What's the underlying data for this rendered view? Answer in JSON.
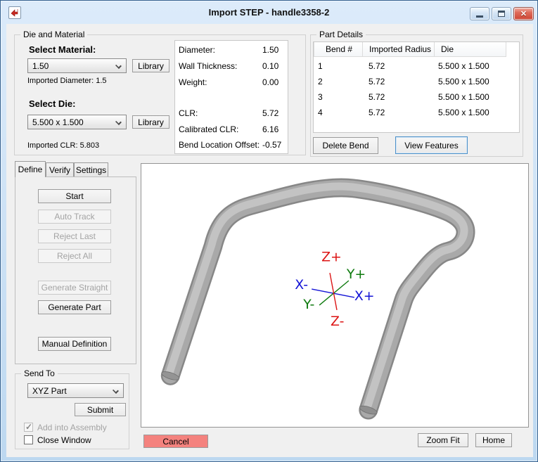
{
  "window": {
    "title": "Import STEP - handle3358-2",
    "controls": {
      "minimize": "minimize-icon",
      "maximize": "maximize-icon",
      "close": "close-icon",
      "close_glyph": "✕"
    }
  },
  "die_and_material": {
    "group_label": "Die and Material",
    "select_material_label": "Select Material:",
    "material_value": "1.50",
    "material_library_button": "Library",
    "imported_diameter": "Imported Diameter: 1.5",
    "select_die_label": "Select Die:",
    "die_value": "5.500 x 1.500",
    "die_library_button": "Library",
    "imported_clr": "Imported CLR: 5.803"
  },
  "material_details": {
    "rows": [
      {
        "label": "Diameter:",
        "value": "1.50"
      },
      {
        "label": "Wall Thickness:",
        "value": "0.10"
      },
      {
        "label": "Weight:",
        "value": "0.00"
      },
      {
        "label": "CLR:",
        "value": "5.72"
      },
      {
        "label": "Calibrated CLR:",
        "value": "6.16"
      },
      {
        "label": "Bend Location Offset:",
        "value": "-0.57"
      }
    ]
  },
  "part_details": {
    "group_label": "Part Details",
    "columns": [
      "Bend #",
      "Imported Radius",
      "Die"
    ],
    "rows": [
      [
        "1",
        "5.72",
        "5.500 x 1.500"
      ],
      [
        "2",
        "5.72",
        "5.500 x 1.500"
      ],
      [
        "3",
        "5.72",
        "5.500 x 1.500"
      ],
      [
        "4",
        "5.72",
        "5.500 x 1.500"
      ]
    ],
    "delete_bend_button": "Delete Bend",
    "view_features_button": "View Features"
  },
  "tabs": {
    "define": "Define",
    "verify": "Verify",
    "settings": "Settings",
    "active_tab": "Define"
  },
  "define_tab": {
    "start_button": "Start",
    "auto_track_button": "Auto Track",
    "reject_last_button": "Reject Last",
    "reject_all_button": "Reject All",
    "generate_straight_button": "Generate Straight",
    "generate_part_button": "Generate Part",
    "manual_definition_button": "Manual Definition",
    "disabled_buttons": [
      "Auto Track",
      "Reject Last",
      "Reject All",
      "Generate Straight"
    ]
  },
  "send_to": {
    "group_label": "Send To",
    "target_value": "XYZ Part",
    "submit_button": "Submit",
    "add_into_assembly_label": "Add into Assembly",
    "add_into_assembly_checked": true,
    "add_into_assembly_enabled": false,
    "close_window_label": "Close Window",
    "close_window_checked": false
  },
  "viewport": {
    "axes": {
      "x_plus": "X+",
      "x_minus": "X-",
      "y_plus": "Y+",
      "y_minus": "Y-",
      "z_plus": "Z+",
      "z_minus": "Z-"
    },
    "axis_colors": {
      "x": "#1414d6",
      "y": "#0e7a0e",
      "z": "#dc1414"
    },
    "tube_color": "#ababab"
  },
  "footer": {
    "cancel_button": "Cancel",
    "cancel_color": "#f4827e",
    "zoom_fit_button": "Zoom Fit",
    "home_button": "Home"
  }
}
